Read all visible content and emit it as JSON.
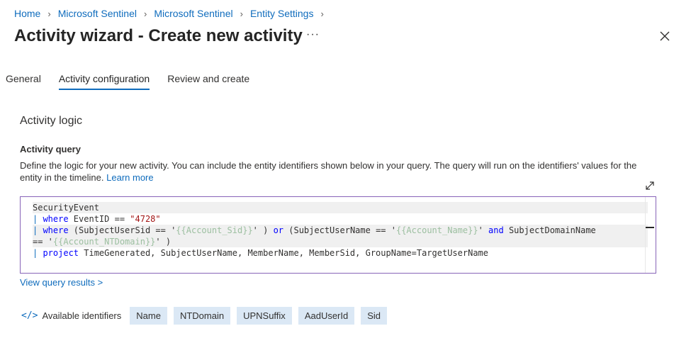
{
  "breadcrumb": [
    "Home",
    "Microsoft Sentinel",
    "Microsoft Sentinel",
    "Entity Settings"
  ],
  "title": "Activity wizard - Create new activity",
  "more_label": "···",
  "tabs": [
    "General",
    "Activity configuration",
    "Review and create"
  ],
  "active_tab": "Activity configuration",
  "section_title": "Activity logic",
  "query_label": "Activity query",
  "description": "Define the logic for your new activity. You can include the entity identifiers shown below in your query. The query will run on the identifiers' values for the entity in the timeline.",
  "learn_more": "Learn more",
  "code": {
    "l1": "SecurityEvent",
    "l2_kw": "where",
    "l2_rest": " EventID == ",
    "l2_str": "\"4728\"",
    "l3_kw": "where",
    "l3_a": " (SubjectUserSid == '",
    "l3_ph1": "{{Account_Sid}}",
    "l3_b": "' ) ",
    "l3_or": "or",
    "l3_c": " (SubjectUserName == '",
    "l3_ph2": "{{Account_Name}}",
    "l3_d": "' ",
    "l3_and": "and",
    "l3_e": " SubjectDomainName",
    "l4_a": "== '",
    "l4_ph": "{{Account_NTDomain}}",
    "l4_b": "' )",
    "l5_kw": "project",
    "l5_rest": " TimeGenerated, SubjectUserName, MemberName, MemberSid, GroupName=TargetUserName"
  },
  "view_results": "View query results >",
  "identifiers_label": "Available identifiers",
  "identifiers": [
    "Name",
    "NTDomain",
    "UPNSuffix",
    "AadUserId",
    "Sid"
  ],
  "colors": {
    "accent": "#0f6cbd",
    "editor_border": "#8764b8",
    "chip_bg": "#dbe8f5"
  }
}
